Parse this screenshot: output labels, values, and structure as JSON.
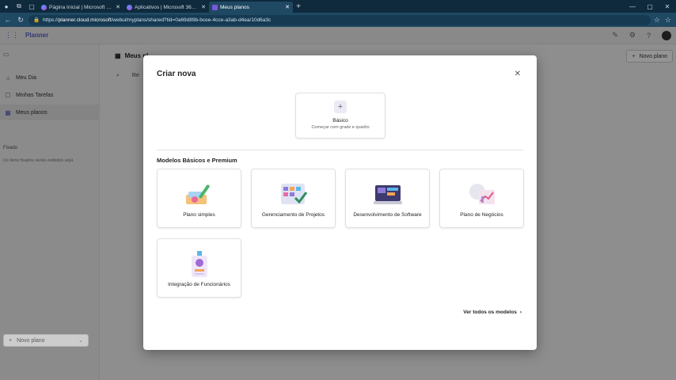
{
  "browser": {
    "tabs": [
      {
        "label": "Página Inicial | Microsoft 365 Co"
      },
      {
        "label": "Aplicativos | Microsoft 365 Copi"
      },
      {
        "label": "Meus planos"
      }
    ],
    "url_prefix": "https://",
    "url_host": "planner.cloud.microsoft",
    "url_path": "/webui/myplans/shared?tid=0a69d89b-bcee-4cce-a3ab-d4ea/10d6a3c"
  },
  "app": {
    "name": "Planner",
    "sidebar": {
      "items": [
        {
          "label": "Meu Dia"
        },
        {
          "label": "Minhas Tarefas"
        },
        {
          "label": "Meus planos"
        }
      ],
      "pinned_label": "Fixado",
      "pinned_note": "Os itens fixados serão exibidos aqui.",
      "new_plan": "Novo plano"
    },
    "main": {
      "title": "Meus pl",
      "new_plan": "Novo plano",
      "search_prefix": "Re"
    }
  },
  "modal": {
    "title": "Criar nova",
    "basic": {
      "name": "Básico",
      "desc": "Começar com grade e quadro"
    },
    "section_title": "Modelos Básicos e Premium",
    "templates": [
      {
        "name": "Plano simples"
      },
      {
        "name": "Gerenciamento de Projetos"
      },
      {
        "name": "Desenvolvimento de Software"
      },
      {
        "name": "Plano de Negócios"
      },
      {
        "name": "Integração de Funcionários"
      }
    ],
    "see_all": "Ver todos os modelos"
  },
  "colors": {
    "accent": "#5b5fc7",
    "chrome": "#1f4863"
  }
}
